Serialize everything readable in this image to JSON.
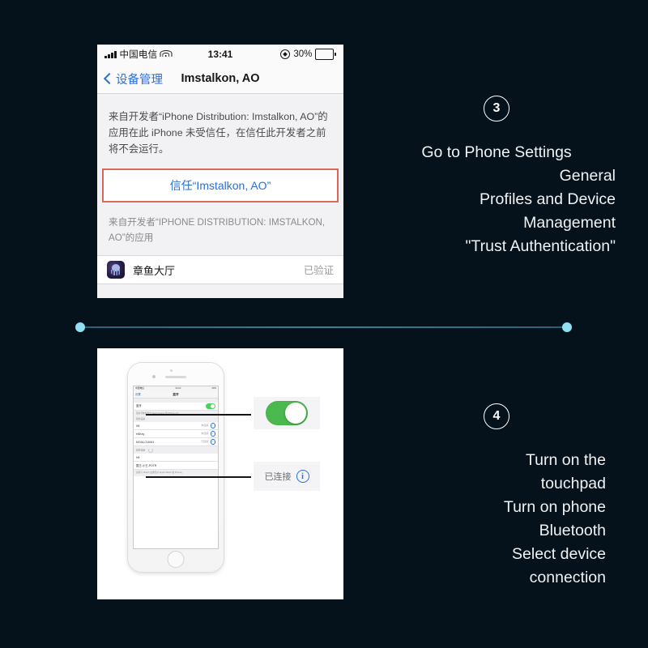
{
  "page": {
    "background_color": "#05121c",
    "accent_color": "#8fe0f5"
  },
  "step3": {
    "badge": "3",
    "lines": [
      "Go to Phone Settings",
      "General",
      "Profiles and Device",
      "Management",
      "\"Trust Authentication\""
    ],
    "screenshot": {
      "status_bar": {
        "carrier": "中国电信",
        "time": "13:41",
        "battery_percent": "30%",
        "battery_level": 30,
        "signal_icon": "signal-bars-icon",
        "wifi_icon": "wifi-icon",
        "location_icon": "location-services-icon",
        "battery_icon": "battery-icon"
      },
      "nav": {
        "back_label": "设备管理",
        "back_icon": "chevron-left-icon",
        "title": "Imstalkon, AO"
      },
      "description": "来自开发者“iPhone Distribution: Imstalkon, AO”的应用在此 iPhone 未受信任，在信任此开发者之前将不会运行。",
      "trust_button": "信任“Imstalkon, AO”",
      "trust_button_border_color": "#d9695a",
      "trust_button_text_color": "#2b6fd4",
      "section_header": "来自开发者“IPHONE DISTRIBUTION: IMSTALKON, AO”的应用",
      "app_row": {
        "icon": "octopus-app-icon",
        "name": "章鱼大厅",
        "status": "已验证"
      }
    }
  },
  "step4": {
    "badge": "4",
    "lines": [
      "Turn on the",
      "touchpad",
      "Turn on phone",
      "Bluetooth",
      "Select device",
      "connection"
    ],
    "photo": {
      "device": "white-iphone",
      "mini_screen": {
        "status": {
          "carrier": "中国电信",
          "time": "14:10",
          "battery": "40%"
        },
        "nav": {
          "back_label": "设置",
          "title": "蓝牙"
        },
        "bluetooth_row": {
          "label": "蓝牙",
          "toggle_on": true
        },
        "note": "现在可被发现为“David Huang 的 iPhone (2)”。",
        "my_devices_header": "我的设备",
        "devices": [
          {
            "name": "H6",
            "status": "未连接"
          },
          {
            "name": "H6Key",
            "status": "未连接"
          },
          {
            "name": "MOJA,C16341",
            "status": "已连接"
          }
        ],
        "other_header": "其他设备",
        "other_devices": [
          {
            "name": "H6"
          },
          {
            "name": "国王-小王-POTR"
          }
        ],
        "footer": "如需与 Watch 这类配对 Apple Watch 和 iPhone。"
      },
      "callouts": [
        {
          "type": "toggle",
          "state": "on",
          "color": "#4bb94f"
        },
        {
          "type": "status",
          "label": "已连接",
          "icon": "info-circle-icon"
        }
      ]
    }
  }
}
